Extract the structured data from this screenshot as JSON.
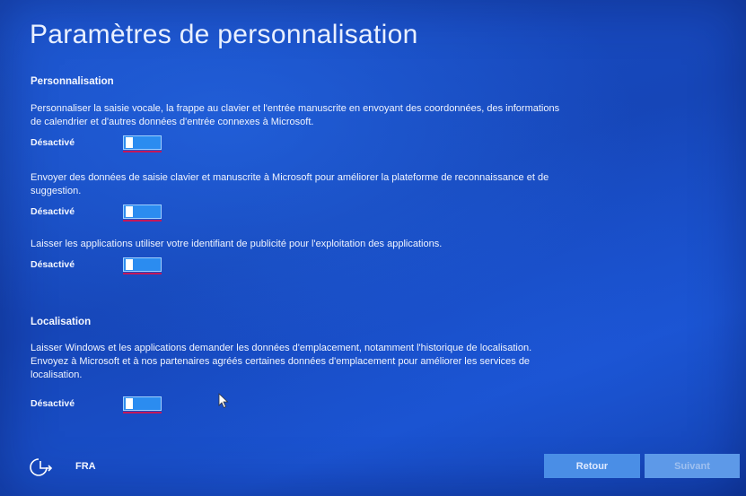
{
  "page": {
    "title": "Paramètres de personnalisation"
  },
  "personalization": {
    "heading": "Personnalisation",
    "settings": [
      {
        "description": "Personnaliser la saisie vocale, la frappe au clavier et l'entrée manuscrite en envoyant des coordonnées, des informations de calendrier et d'autres données d'entrée connexes à Microsoft.",
        "state": "Désactivé",
        "on": false
      },
      {
        "description": "Envoyer des données de saisie clavier et manuscrite à Microsoft pour améliorer la plateforme de reconnaissance et de suggestion.",
        "state": "Désactivé",
        "on": false
      },
      {
        "description": "Laisser les applications utiliser votre identifiant de publicité pour l'exploitation des applications.",
        "state": "Désactivé",
        "on": false
      }
    ]
  },
  "location": {
    "heading": "Localisation",
    "settings": [
      {
        "description": "Laisser Windows et les applications demander les données d'emplacement, notamment l'historique de localisation. Envoyez à Microsoft et à nos partenaires agréés certaines données d'emplacement pour améliorer les services de localisation.",
        "state": "Désactivé",
        "on": false
      }
    ]
  },
  "footer": {
    "language": "FRA",
    "back_label": "Retour",
    "next_label": "Suivant"
  },
  "colors": {
    "background": "#1a4fc8",
    "toggle_fill": "#2b8cf0",
    "toggle_focus": "#c2185b"
  },
  "icons": {
    "language": "ease-of-access-icon",
    "cursor": "mouse-pointer-icon"
  }
}
